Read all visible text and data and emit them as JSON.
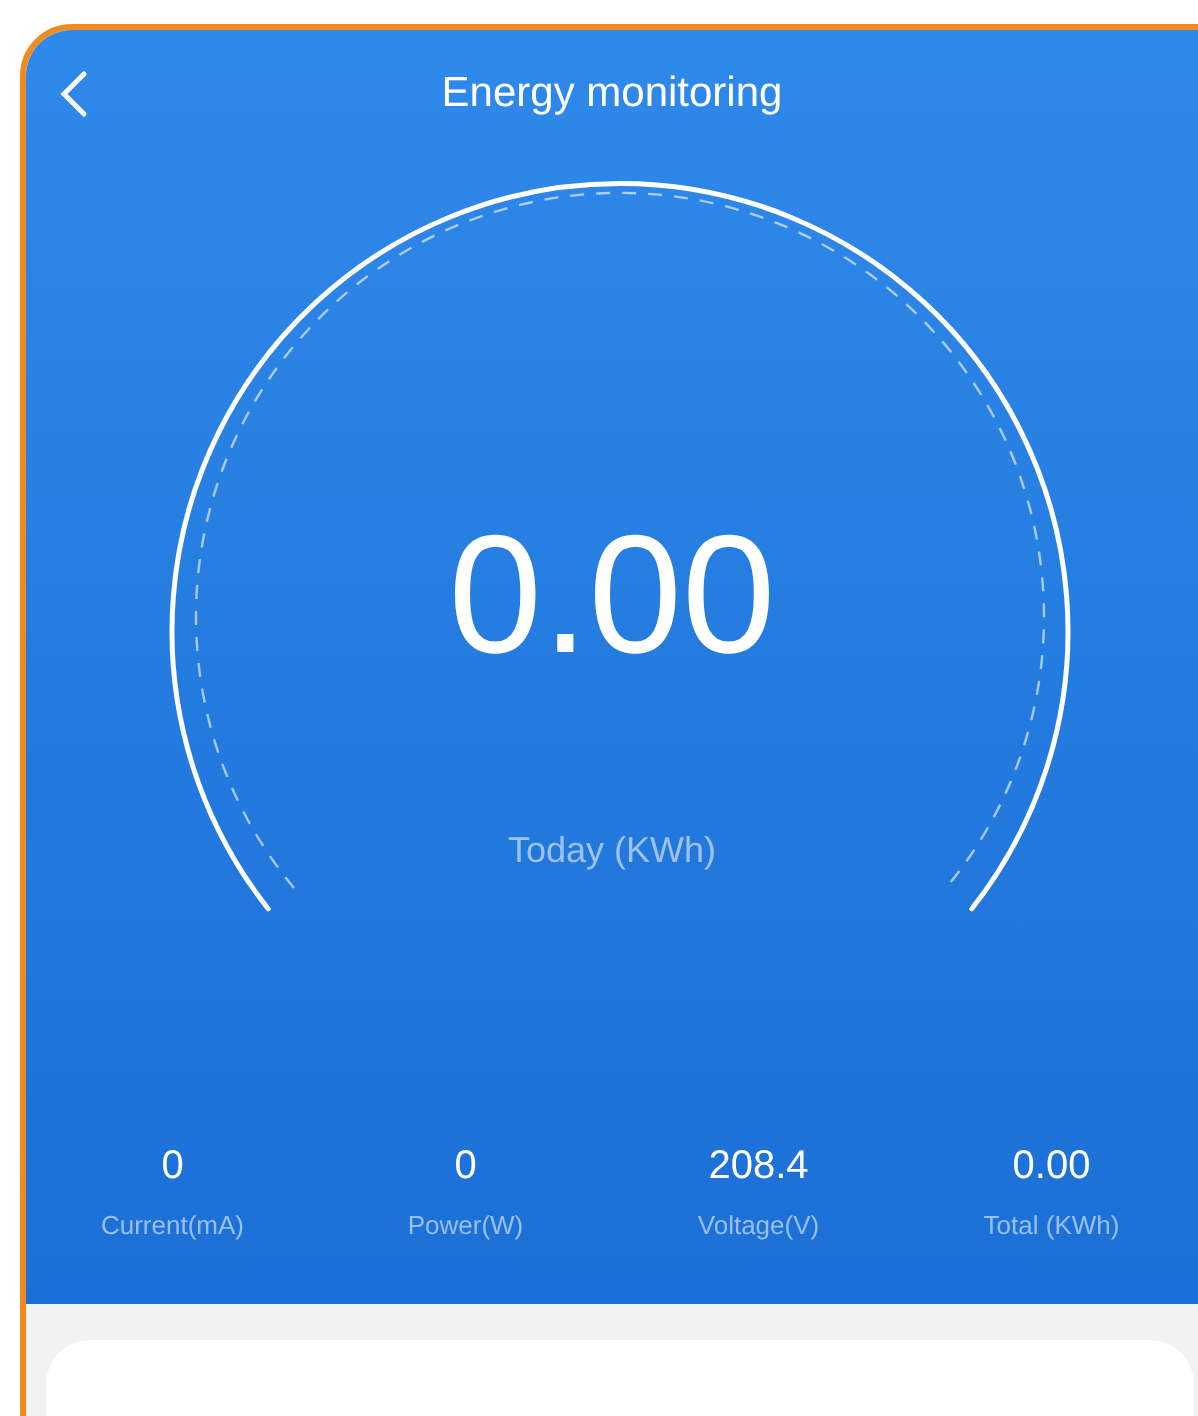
{
  "header": {
    "title": "Energy monitoring"
  },
  "gauge": {
    "value": "0.00",
    "caption": "Today (KWh)"
  },
  "stats": [
    {
      "value": "0",
      "label": "Current(mA)"
    },
    {
      "value": "0",
      "label": "Power(W)"
    },
    {
      "value": "208.4",
      "label": "Voltage(V)"
    },
    {
      "value": "0.00",
      "label": "Total (KWh)"
    }
  ]
}
